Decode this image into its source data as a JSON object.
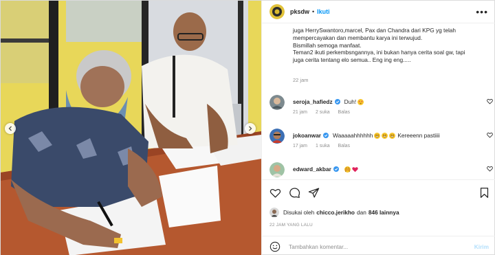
{
  "post": {
    "username": "pksdw",
    "follow_label": "Ikuti",
    "header_dot": "•",
    "more_label": "•••"
  },
  "caption": {
    "lines": [
      "juga HerrySwantoro,marcel, Pax dan Chandra dari KPG yg telah",
      "mempercayakan dan membantu karya ini terwujud.",
      "Bismillah semoga manfaat.",
      "Teman2 ikuti perkembsngannya, ini bukan hanya cerita soal gw, tapi",
      "juga cerita tentang elo semua.. Eng ing eng....."
    ],
    "time": "22 jam"
  },
  "comments": [
    {
      "username": "seroja_hafiedz",
      "verified": true,
      "text": "Duh!",
      "emoji": [
        "heart-eyes-emoji"
      ],
      "time": "21 jam",
      "likes": "2 suka",
      "reply": "Balas"
    },
    {
      "username": "jokoanwar",
      "verified": true,
      "text": "Waaaaahhhhhh",
      "emoji": [
        "grin-emoji",
        "grin-emoji",
        "grin-emoji"
      ],
      "text2": "Kereeenn pastiiii",
      "time": "17 jam",
      "likes": "1 suka",
      "reply": "Balas"
    },
    {
      "username": "edward_akbar",
      "verified": true,
      "text": "",
      "emoji": [
        "raised-hands-emoji",
        "red-heart-emoji"
      ]
    }
  ],
  "likes": {
    "prefix": "Disukai oleh",
    "user": "chicco.jerikho",
    "and": "dan",
    "count": "846 lainnya"
  },
  "posted_label": "22 JAM YANG LALU",
  "add_comment": {
    "placeholder": "Tambahkan komentar...",
    "post_label": "Kirim"
  },
  "colors": {
    "link_blue": "#0095f6",
    "verified_blue": "#3897f0",
    "muted_gray": "#8e8e8e",
    "post_disabled": "#b2dffc"
  }
}
